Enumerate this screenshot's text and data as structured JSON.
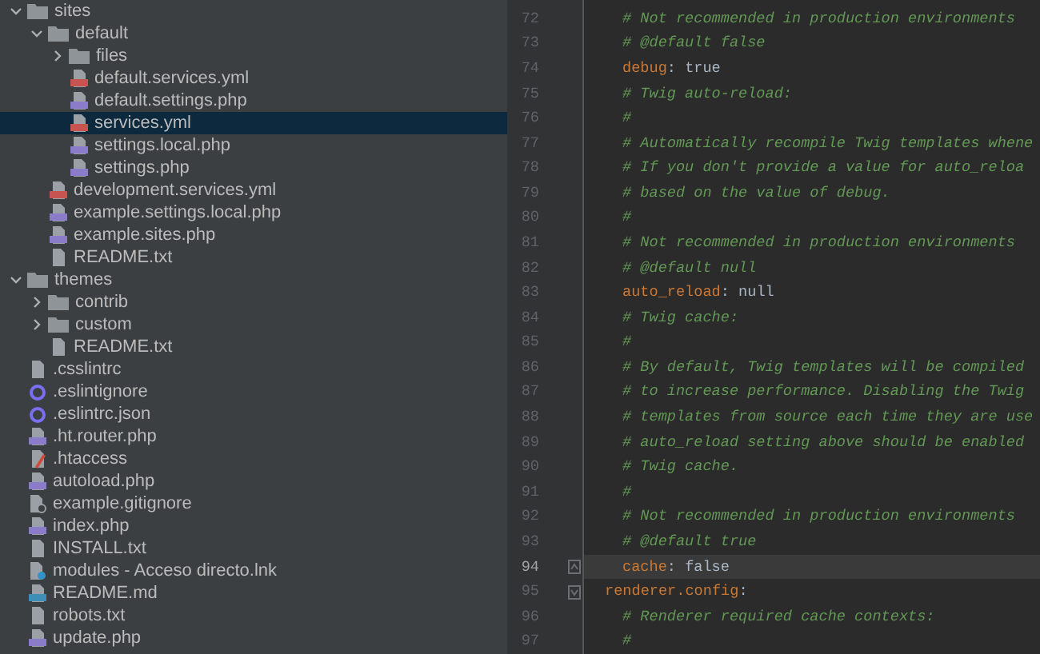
{
  "project_tree": [
    {
      "name": "sites",
      "kind": "folder",
      "expanded": true,
      "selected": false,
      "children": [
        {
          "name": "default",
          "kind": "folder",
          "expanded": true,
          "selected": false,
          "children": [
            {
              "name": "files",
              "kind": "folder",
              "expanded": false,
              "selected": false
            },
            {
              "name": "default.services.yml",
              "kind": "yml",
              "selected": false
            },
            {
              "name": "default.settings.php",
              "kind": "php",
              "selected": false
            },
            {
              "name": "services.yml",
              "kind": "yml",
              "selected": true
            },
            {
              "name": "settings.local.php",
              "kind": "php",
              "selected": false
            },
            {
              "name": "settings.php",
              "kind": "php",
              "selected": false
            }
          ]
        },
        {
          "name": "development.services.yml",
          "kind": "yml",
          "selected": false
        },
        {
          "name": "example.settings.local.php",
          "kind": "php",
          "selected": false
        },
        {
          "name": "example.sites.php",
          "kind": "php",
          "selected": false
        },
        {
          "name": "README.txt",
          "kind": "text",
          "selected": false
        }
      ]
    },
    {
      "name": "themes",
      "kind": "folder",
      "expanded": true,
      "selected": false,
      "children": [
        {
          "name": "contrib",
          "kind": "folder",
          "expanded": false,
          "selected": false
        },
        {
          "name": "custom",
          "kind": "folder",
          "expanded": false,
          "selected": false
        },
        {
          "name": "README.txt",
          "kind": "text",
          "selected": false
        }
      ]
    },
    {
      "name": ".csslintrc",
      "kind": "text",
      "selected": false
    },
    {
      "name": ".eslintignore",
      "kind": "eslint",
      "selected": false
    },
    {
      "name": ".eslintrc.json",
      "kind": "eslint",
      "selected": false
    },
    {
      "name": ".ht.router.php",
      "kind": "php",
      "selected": false
    },
    {
      "name": ".htaccess",
      "kind": "htaccess",
      "selected": false
    },
    {
      "name": "autoload.php",
      "kind": "php",
      "selected": false
    },
    {
      "name": "example.gitignore",
      "kind": "gitignore",
      "selected": false
    },
    {
      "name": "index.php",
      "kind": "php",
      "selected": false
    },
    {
      "name": "INSTALL.txt",
      "kind": "text",
      "selected": false
    },
    {
      "name": "modules - Acceso directo.lnk",
      "kind": "shortcut",
      "selected": false
    },
    {
      "name": "README.md",
      "kind": "markdown",
      "selected": false
    },
    {
      "name": "robots.txt",
      "kind": "text",
      "selected": false
    },
    {
      "name": "update.php",
      "kind": "php",
      "selected": false
    }
  ],
  "editor": {
    "lines": [
      {
        "number": "72",
        "kind": "comment",
        "text": "# Not recommended in production environments"
      },
      {
        "number": "73",
        "kind": "comment",
        "text": "# @default false"
      },
      {
        "number": "74",
        "kind": "pair",
        "key": "debug",
        "value": ": true"
      },
      {
        "number": "75",
        "kind": "comment",
        "text": "# Twig auto-reload:"
      },
      {
        "number": "76",
        "kind": "comment",
        "text": "#"
      },
      {
        "number": "77",
        "kind": "comment",
        "text": "# Automatically recompile Twig templates whene"
      },
      {
        "number": "78",
        "kind": "comment",
        "text": "# If you don't provide a value for auto_reloa"
      },
      {
        "number": "79",
        "kind": "comment",
        "text": "# based on the value of debug."
      },
      {
        "number": "80",
        "kind": "comment",
        "text": "#"
      },
      {
        "number": "81",
        "kind": "comment",
        "text": "# Not recommended in production environments"
      },
      {
        "number": "82",
        "kind": "comment",
        "text": "# @default null"
      },
      {
        "number": "83",
        "kind": "pair",
        "key": "auto_reload",
        "value": ": null"
      },
      {
        "number": "84",
        "kind": "comment",
        "text": "# Twig cache:"
      },
      {
        "number": "85",
        "kind": "comment",
        "text": "#"
      },
      {
        "number": "86",
        "kind": "comment",
        "text": "# By default, Twig templates will be compiled"
      },
      {
        "number": "87",
        "kind": "comment",
        "text": "# to increase performance. Disabling the Twig"
      },
      {
        "number": "88",
        "kind": "comment",
        "text": "# templates from source each time they are use"
      },
      {
        "number": "89",
        "kind": "comment",
        "text": "# auto_reload setting above should be enabled"
      },
      {
        "number": "90",
        "kind": "comment",
        "text": "# Twig cache."
      },
      {
        "number": "91",
        "kind": "comment",
        "text": "#"
      },
      {
        "number": "92",
        "kind": "comment",
        "text": "# Not recommended in production environments"
      },
      {
        "number": "93",
        "kind": "comment",
        "text": "# @default true"
      },
      {
        "number": "94",
        "kind": "pair",
        "key": "cache",
        "value": ": false",
        "current": true,
        "fold_end": true
      },
      {
        "number": "95",
        "kind": "section",
        "key": "renderer.config",
        "punctuation": ":",
        "fold_start": true
      },
      {
        "number": "96",
        "kind": "comment",
        "text": "# Renderer required cache contexts:"
      },
      {
        "number": "97",
        "kind": "comment",
        "text": "#"
      }
    ]
  }
}
